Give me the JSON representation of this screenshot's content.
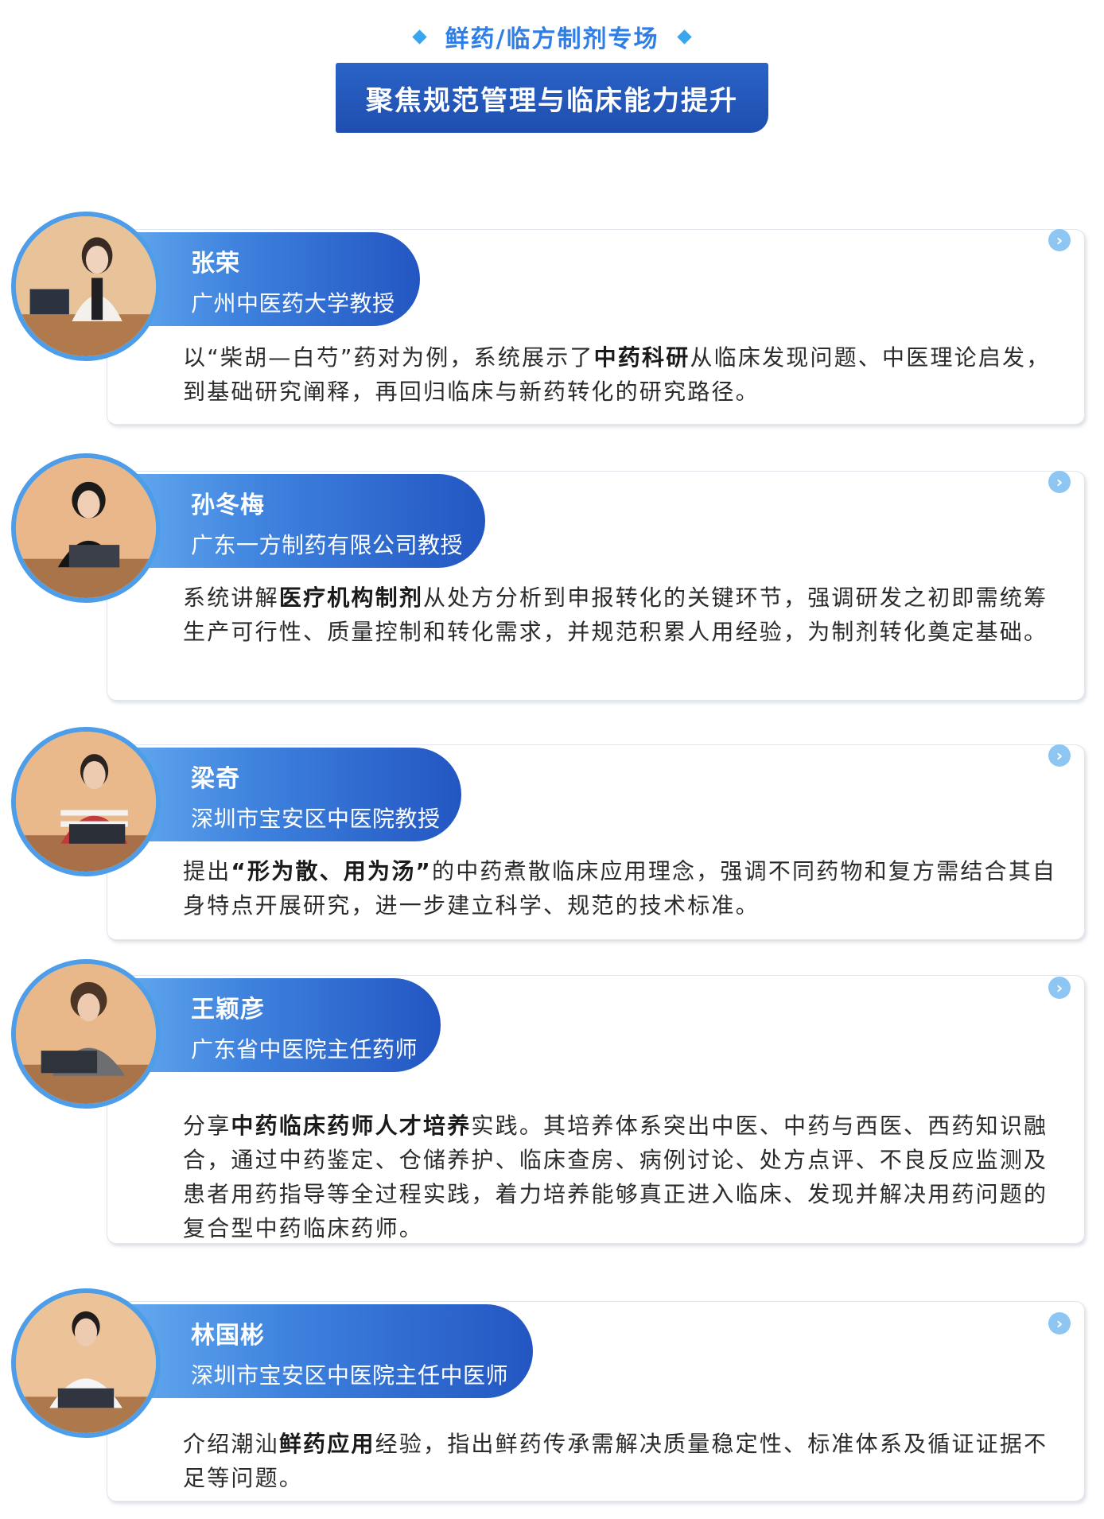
{
  "header": {
    "section_label": "鲜药/临方制剂专场",
    "title": "聚焦规范管理与临床能力提升"
  },
  "speakers": [
    {
      "name": "张荣",
      "role": "广州中医药大学教授",
      "desc": [
        {
          "t": "以“柴胡—白芍”药对为例，系统展示了",
          "b": false
        },
        {
          "t": "中药科研",
          "b": true
        },
        {
          "t": "从临床发现问题、中医理论启发，到基础研究阐释，再回归临床与新药转化的研究路径。",
          "b": false
        }
      ]
    },
    {
      "name": "孙冬梅",
      "role": "广东一方制药有限公司教授",
      "desc": [
        {
          "t": "系统讲解",
          "b": false
        },
        {
          "t": "医疗机构制剂",
          "b": true
        },
        {
          "t": "从处方分析到申报转化的关键环节，强调研发之初即需统筹生产可行性、质量控制和转化需求，并规范积累人用经验，为制剂转化奠定基础。",
          "b": false
        }
      ]
    },
    {
      "name": "梁奇",
      "role": "深圳市宝安区中医院教授",
      "desc": [
        {
          "t": "提出",
          "b": false
        },
        {
          "t": "“形为散、用为汤”",
          "b": true
        },
        {
          "t": "的中药煮散临床应用理念，强调不同药物和复方需结合其自身特点开展研究，进一步建立科学、规范的技术标准。",
          "b": false
        }
      ]
    },
    {
      "name": "王颖彦",
      "role": "广东省中医院主任药师",
      "desc": [
        {
          "t": "分享",
          "b": false
        },
        {
          "t": "中药临床药师人才培养",
          "b": true
        },
        {
          "t": "实践。其培养体系突出中医、中药与西医、西药知识融合，通过中药鉴定、仓储养护、临床查房、病例讨论、处方点评、不良反应监测及患者用药指导等全过程实践，着力培养能够真正进入临床、发现并解决用药问题的复合型中药临床药师。",
          "b": false
        }
      ]
    },
    {
      "name": "林国彬",
      "role": "深圳市宝安区中医院主任中医师",
      "desc": [
        {
          "t": "介绍潮汕",
          "b": false
        },
        {
          "t": "鲜药应用",
          "b": true
        },
        {
          "t": "经验，指出鲜药传承需解决质量稳定性、标准体系及循证证据不足等问题。",
          "b": false
        }
      ]
    }
  ],
  "colors": {
    "accent_blue": "#2f7ee6",
    "title_bg": "#2356c2",
    "ribbon_light": "#6db3f2",
    "arrow_bg": "#8ec6f3"
  },
  "icons": {
    "diamond": "diamond-icon",
    "arrow": "chevron-right-circle-icon"
  }
}
